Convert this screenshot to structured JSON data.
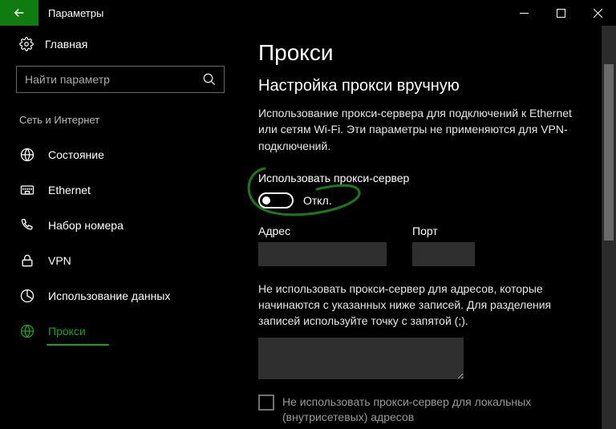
{
  "titlebar": {
    "title": "Параметры"
  },
  "sidebar": {
    "home_label": "Главная",
    "search_placeholder": "Найти параметр",
    "section_label": "Сеть и Интернет",
    "items": [
      {
        "label": "Состояние"
      },
      {
        "label": "Ethernet"
      },
      {
        "label": "Набор номера"
      },
      {
        "label": "VPN"
      },
      {
        "label": "Использование данных"
      },
      {
        "label": "Прокси"
      }
    ]
  },
  "main": {
    "page_title": "Прокси",
    "section_title": "Настройка прокси вручную",
    "description": "Использование прокси-сервера для подключений к Ethernet или сетям Wi-Fi. Эти параметры не применяются для VPN-подключений.",
    "toggle_label": "Использовать прокси-сервер",
    "toggle_state": "Откл.",
    "address_label": "Адрес",
    "address_value": "",
    "port_label": "Порт",
    "port_value": "",
    "exclusions_desc": "Не использовать прокси-сервер для адресов, которые начинаются с указанных ниже записей. Для разделения записей используйте точку с запятой (;).",
    "exclusions_value": "",
    "local_bypass_label": "Не использовать прокси-сервер для локальных (внутрисетевых) адресов"
  }
}
